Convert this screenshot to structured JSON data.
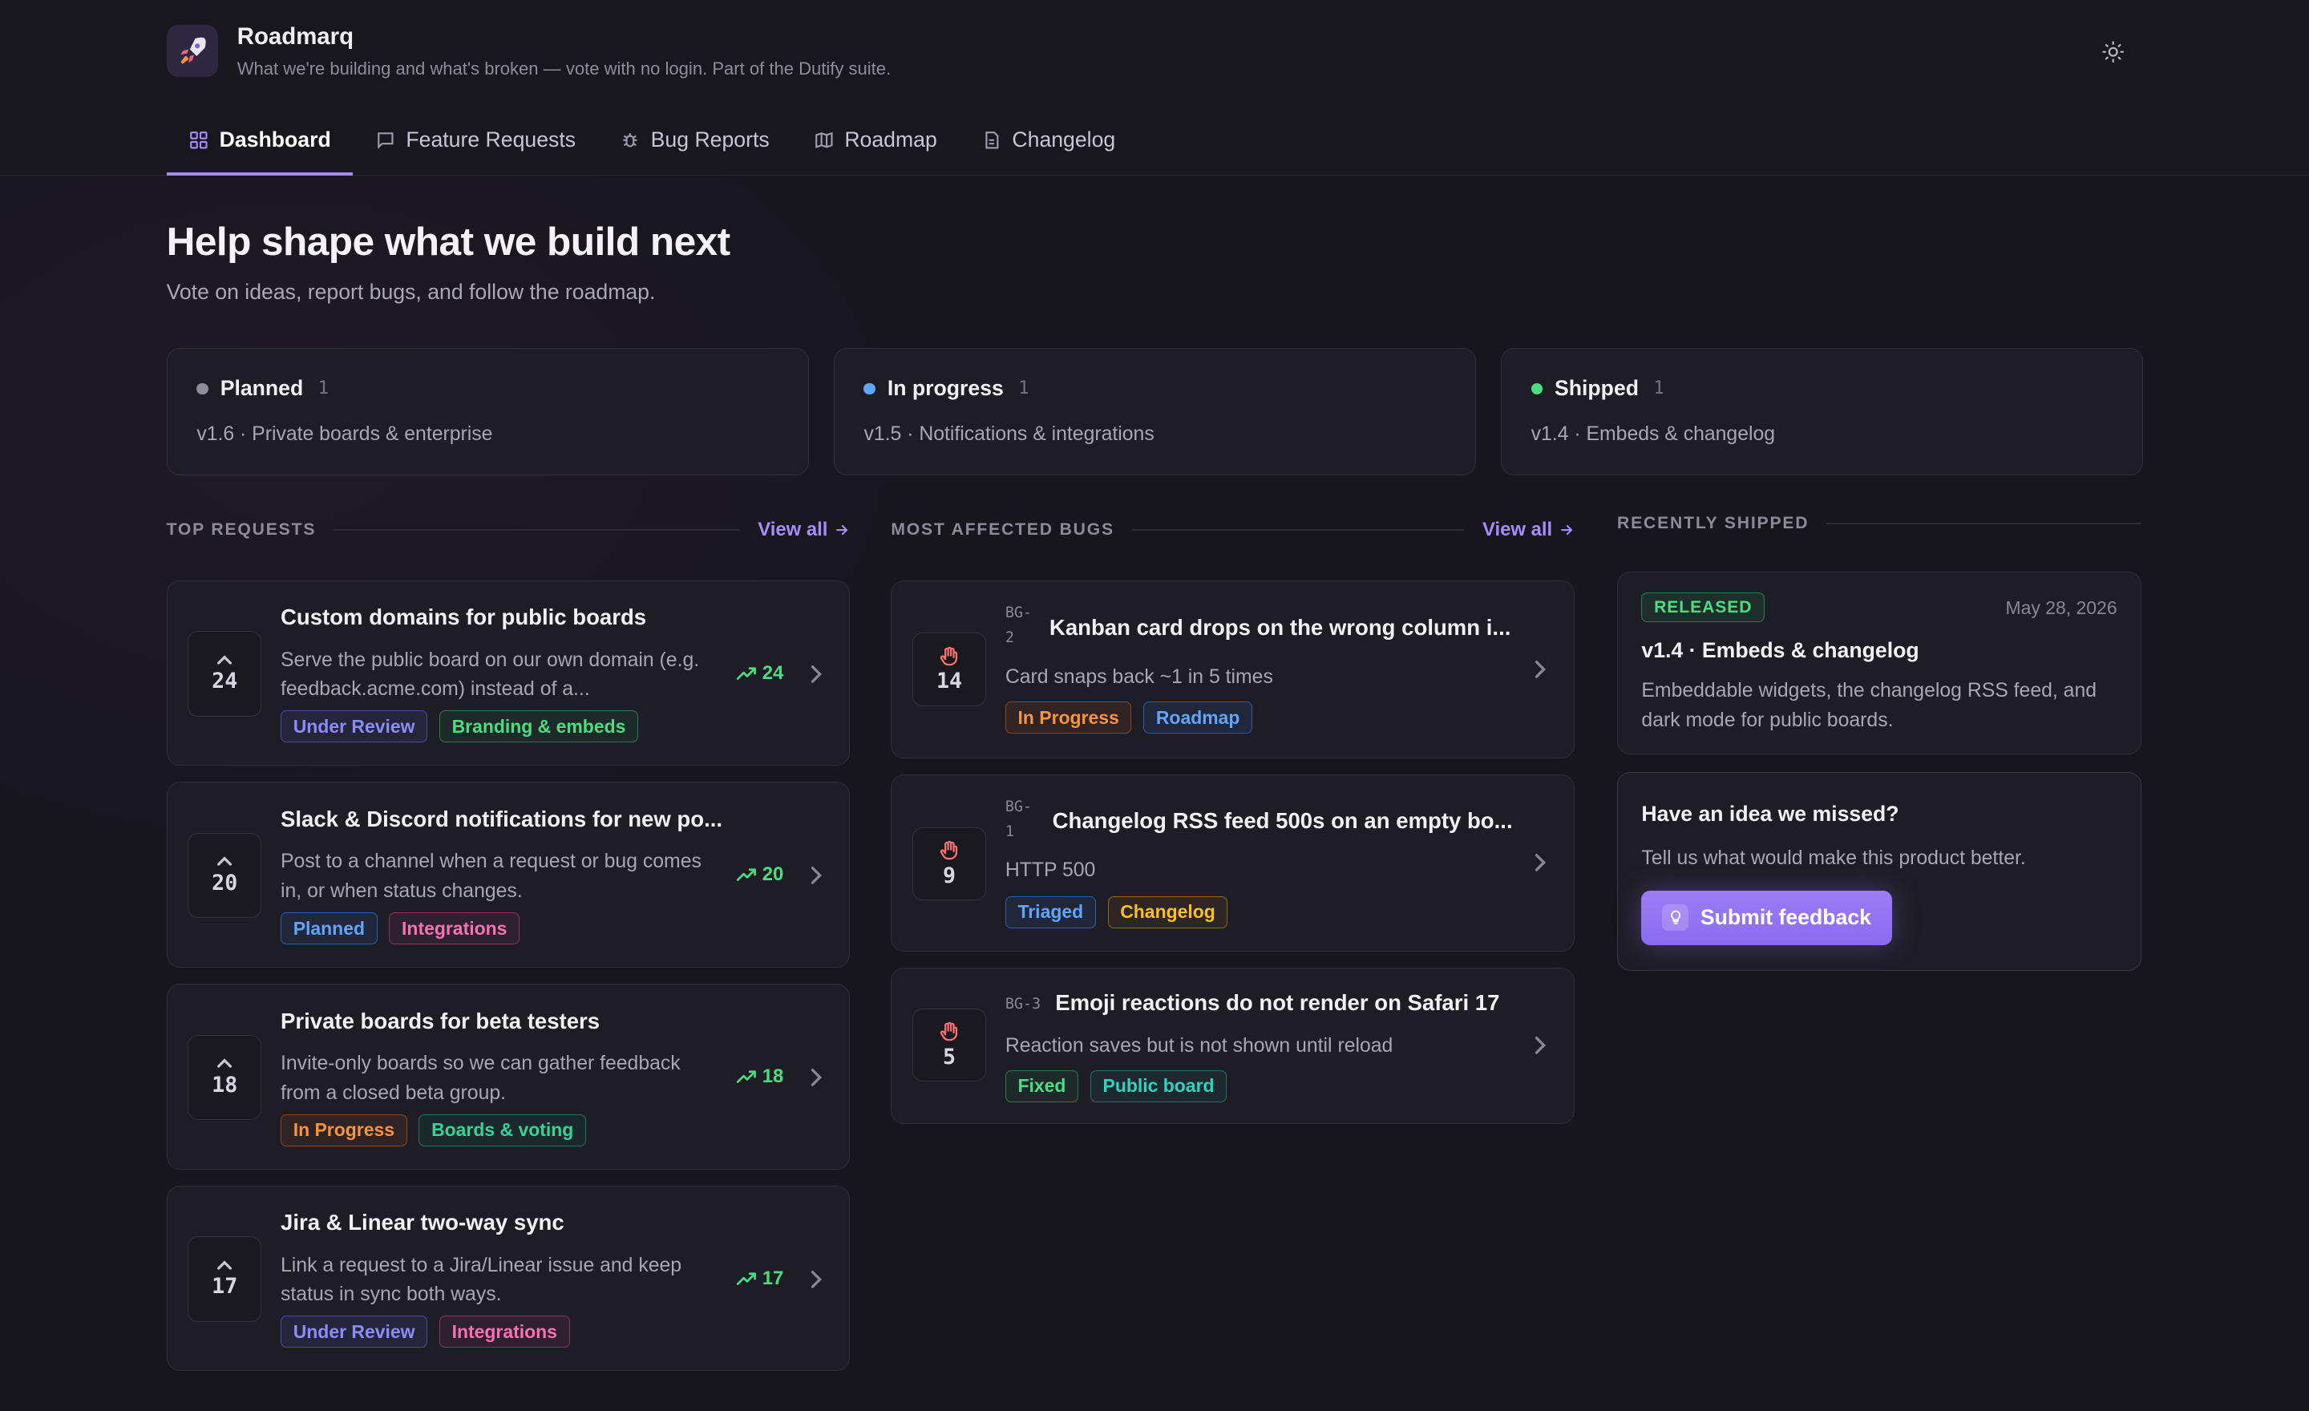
{
  "app": {
    "name": "Roadmarq",
    "tagline": "What we're building and what's broken — vote with no login. Part of the Dutify suite.",
    "logo_icon": "rocket-icon",
    "theme_icon": "sun-icon"
  },
  "tabs": [
    {
      "label": "Dashboard",
      "icon": "grid-icon",
      "active": true
    },
    {
      "label": "Feature Requests",
      "icon": "message-icon",
      "active": false
    },
    {
      "label": "Bug Reports",
      "icon": "bug-icon",
      "active": false
    },
    {
      "label": "Roadmap",
      "icon": "map-icon",
      "active": false
    },
    {
      "label": "Changelog",
      "icon": "document-icon",
      "active": false
    }
  ],
  "hero": {
    "title": "Help shape what we build next",
    "subtitle": "Vote on ideas, report bugs, and follow the roadmap."
  },
  "status_cards": [
    {
      "name": "Planned",
      "count": "1",
      "desc": "v1.6 · Private boards & enterprise",
      "color": "#8f8c9b"
    },
    {
      "name": "In progress",
      "count": "1",
      "desc": "v1.5 · Notifications & integrations",
      "color": "#60a5fa"
    },
    {
      "name": "Shipped",
      "count": "1",
      "desc": "v1.4 · Embeds & changelog",
      "color": "#4ade80"
    }
  ],
  "sections": {
    "top_requests": "TOP REQUESTS",
    "most_affected": "MOST AFFECTED BUGS",
    "recently_shipped": "RECENTLY SHIPPED",
    "view_all": "View all"
  },
  "requests": [
    {
      "votes": "24",
      "title": "Custom domains for public boards",
      "desc": "Serve the public board on our own domain (e.g. feedback.acme.com) instead of a...",
      "trend": "24",
      "tags": [
        {
          "label": "Under Review",
          "cls": "t-review"
        },
        {
          "label": "Branding & embeds",
          "cls": "t-brand"
        }
      ]
    },
    {
      "votes": "20",
      "title": "Slack & Discord notifications for new po...",
      "desc": "Post to a channel when a request or bug comes in, or when status changes.",
      "trend": "20",
      "tags": [
        {
          "label": "Planned",
          "cls": "t-planned"
        },
        {
          "label": "Integrations",
          "cls": "t-integ"
        }
      ]
    },
    {
      "votes": "18",
      "title": "Private boards for beta testers",
      "desc": "Invite-only boards so we can gather feedback from a closed beta group.",
      "trend": "18",
      "tags": [
        {
          "label": "In Progress",
          "cls": "t-progress"
        },
        {
          "label": "Boards & voting",
          "cls": "t-boards"
        }
      ]
    },
    {
      "votes": "17",
      "title": "Jira & Linear two-way sync",
      "desc": "Link a request to a Jira/Linear issue and keep status in sync both ways.",
      "trend": "17",
      "tags": [
        {
          "label": "Under Review",
          "cls": "t-review"
        },
        {
          "label": "Integrations",
          "cls": "t-integ"
        }
      ]
    }
  ],
  "bugs": [
    {
      "count": "14",
      "id_line1": "BG-",
      "id_line2": "2",
      "title": "Kanban card drops on the wrong column i...",
      "desc": "Card snaps back ~1 in 5 times",
      "tags": [
        {
          "label": "In Progress",
          "cls": "t-progress"
        },
        {
          "label": "Roadmap",
          "cls": "t-roadmap"
        }
      ]
    },
    {
      "count": "9",
      "id_line1": "BG-",
      "id_line2": "1",
      "title": "Changelog RSS feed 500s on an empty bo...",
      "desc": "HTTP 500",
      "tags": [
        {
          "label": "Triaged",
          "cls": "t-triaged"
        },
        {
          "label": "Changelog",
          "cls": "t-changelog"
        }
      ]
    },
    {
      "count": "5",
      "id_line1": "BG-3",
      "id_line2": "",
      "title": "Emoji reactions do not render on Safari 17",
      "desc": "Reaction saves but is not shown until reload",
      "tags": [
        {
          "label": "Fixed",
          "cls": "t-fixed"
        },
        {
          "label": "Public board",
          "cls": "t-public"
        }
      ]
    }
  ],
  "shipped": {
    "badge": "RELEASED",
    "date": "May 28, 2026",
    "title": "v1.4 · Embeds & changelog",
    "desc": "Embeddable widgets, the changelog RSS feed, and dark mode for public boards."
  },
  "idea": {
    "title": "Have an idea we missed?",
    "subtitle": "Tell us what would make this product better.",
    "button": "Submit feedback",
    "button_icon": "lightbulb-icon"
  }
}
